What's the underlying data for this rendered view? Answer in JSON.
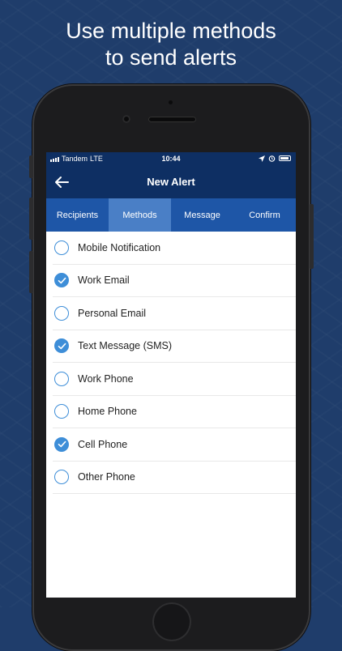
{
  "headline": {
    "line1": "Use multiple methods",
    "line2": "to send alerts"
  },
  "status_bar": {
    "carrier": "Tandem",
    "network": "LTE",
    "time": "10:44",
    "icons": [
      "location-icon",
      "alarm-icon",
      "battery-icon"
    ]
  },
  "nav": {
    "title": "New Alert",
    "back_icon": "back-arrow-icon"
  },
  "tabs": [
    {
      "label": "Recipients",
      "active": false
    },
    {
      "label": "Methods",
      "active": true
    },
    {
      "label": "Message",
      "active": false
    },
    {
      "label": "Confirm",
      "active": false
    }
  ],
  "methods": [
    {
      "label": "Mobile Notification",
      "checked": false
    },
    {
      "label": "Work Email",
      "checked": true
    },
    {
      "label": "Personal Email",
      "checked": false
    },
    {
      "label": "Text Message (SMS)",
      "checked": true
    },
    {
      "label": "Work Phone",
      "checked": false
    },
    {
      "label": "Home Phone",
      "checked": false
    },
    {
      "label": "Cell Phone",
      "checked": true
    },
    {
      "label": "Other Phone",
      "checked": false
    }
  ],
  "colors": {
    "background": "#1f3d6b",
    "navbar": "#0e2f63",
    "tabbar": "#1e56a7",
    "tab_active": "#4a7fc6",
    "check_accent": "#3e8ed8"
  }
}
